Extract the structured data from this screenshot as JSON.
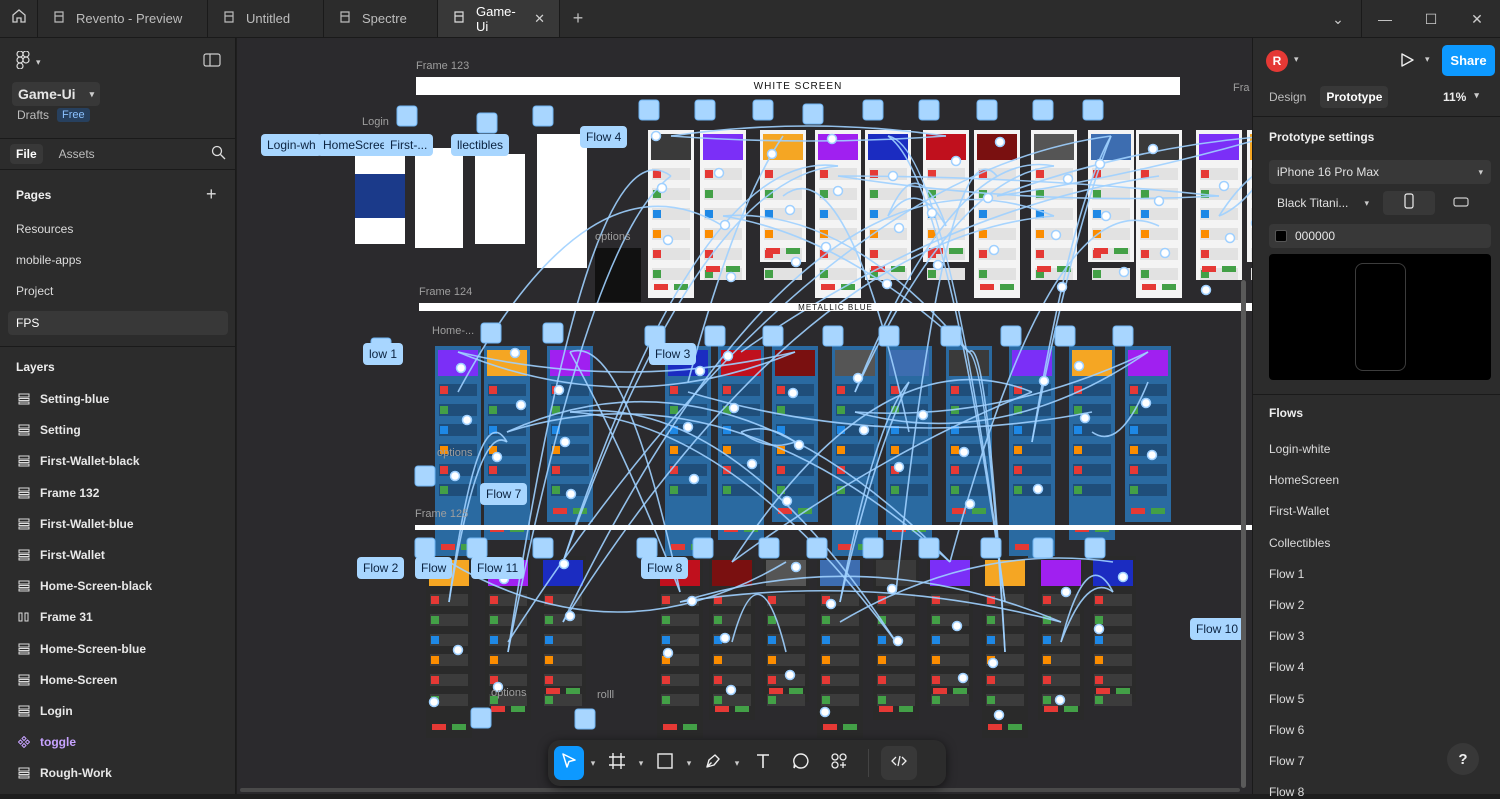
{
  "tabs": [
    {
      "label": "Revento - Preview",
      "active": false
    },
    {
      "label": "Untitled",
      "active": false
    },
    {
      "label": "Spectre",
      "active": false
    },
    {
      "label": "Game-Ui",
      "active": true
    }
  ],
  "file": {
    "name": "Game-Ui",
    "location": "Drafts",
    "plan": "Free"
  },
  "left_tabs": {
    "file": "File",
    "assets": "Assets"
  },
  "pages": {
    "title": "Pages",
    "items": [
      "Resources",
      "mobile-apps",
      "Project",
      "FPS"
    ],
    "active": "FPS"
  },
  "layers": {
    "title": "Layers",
    "items": [
      {
        "label": "Setting-blue",
        "type": "frame"
      },
      {
        "label": "Setting",
        "type": "frame"
      },
      {
        "label": "First-Wallet-black",
        "type": "frame"
      },
      {
        "label": "Frame 132",
        "type": "frame"
      },
      {
        "label": "First-Wallet-blue",
        "type": "frame"
      },
      {
        "label": "First-Wallet",
        "type": "frame"
      },
      {
        "label": "Home-Screen-black",
        "type": "frame"
      },
      {
        "label": "Frame 31",
        "type": "grid"
      },
      {
        "label": "Home-Screen-blue",
        "type": "frame"
      },
      {
        "label": "Home-Screen",
        "type": "frame"
      },
      {
        "label": "Login",
        "type": "frame"
      },
      {
        "label": "toggle",
        "type": "component"
      },
      {
        "label": "Rough-Work",
        "type": "frame"
      }
    ]
  },
  "right": {
    "avatar": "R",
    "share": "Share",
    "tab_design": "Design",
    "tab_prototype": "Prototype",
    "zoom": "11%",
    "settings_title": "Prototype settings",
    "device": "iPhone 16 Pro Max",
    "model": "Black Titani...",
    "bg_color": "000000",
    "flows_title": "Flows",
    "flows": [
      "Login-white",
      "HomeScreen",
      "First-Wallet",
      "Collectibles",
      "Flow 1",
      "Flow 2",
      "Flow 3",
      "Flow 4",
      "Flow 5",
      "Flow 6",
      "Flow 7",
      "Flow 8"
    ]
  },
  "canvas": {
    "banner_white": "WHITE SCREEN",
    "banner_metallic": "METALLIC BLUE",
    "frames": [
      "Frame 123",
      "Frame 124",
      "Frame 125"
    ],
    "small_labels": [
      "Login",
      "options",
      "options",
      "options",
      "rolll",
      "Home-...",
      "Fra"
    ],
    "flow_tags": [
      "Login-wh",
      "HomeScree",
      "First-...",
      "llectibles",
      "Flow 4",
      "low 1",
      "Flow 3",
      "Flow 7",
      "Flow 2",
      "Flow",
      "Flow 11",
      "Flow 8",
      "Flow 10"
    ]
  },
  "colors": {
    "accent": "#0d99ff",
    "connector": "#9fd0ff",
    "component": "#c7a3ff"
  },
  "tools": [
    "move-tool",
    "frame-tool",
    "shape-tool",
    "pen-tool",
    "text-tool",
    "comment-tool",
    "actions-tool",
    "dev-mode-toggle"
  ]
}
